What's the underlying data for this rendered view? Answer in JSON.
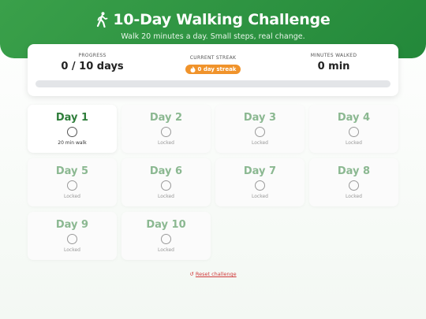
{
  "header": {
    "title": "10-Day Walking Challenge",
    "subtitle": "Walk 20 minutes a day. Small steps, real change.",
    "icon": "walking-person-icon"
  },
  "stats": {
    "progress_label": "PROGRESS",
    "progress_value": "0 / 10 days",
    "progress_fraction": 0,
    "streak_label": "CURRENT STREAK",
    "streak_value": "0 day streak",
    "minutes_label": "MINUTES WALKED",
    "minutes_value": "0 min"
  },
  "days": [
    {
      "title": "Day 1",
      "caption": "20 min walk",
      "locked": false
    },
    {
      "title": "Day 2",
      "caption": "Locked",
      "locked": true
    },
    {
      "title": "Day 3",
      "caption": "Locked",
      "locked": true
    },
    {
      "title": "Day 4",
      "caption": "Locked",
      "locked": true
    },
    {
      "title": "Day 5",
      "caption": "Locked",
      "locked": true
    },
    {
      "title": "Day 6",
      "caption": "Locked",
      "locked": true
    },
    {
      "title": "Day 7",
      "caption": "Locked",
      "locked": true
    },
    {
      "title": "Day 8",
      "caption": "Locked",
      "locked": true
    },
    {
      "title": "Day 9",
      "caption": "Locked",
      "locked": true
    },
    {
      "title": "Day 10",
      "caption": "Locked",
      "locked": true
    }
  ],
  "footer": {
    "reset_label": "Reset challenge"
  },
  "colors": {
    "brand": "#2f9642",
    "streak": "#f0932b",
    "reset": "#d03b3b"
  }
}
